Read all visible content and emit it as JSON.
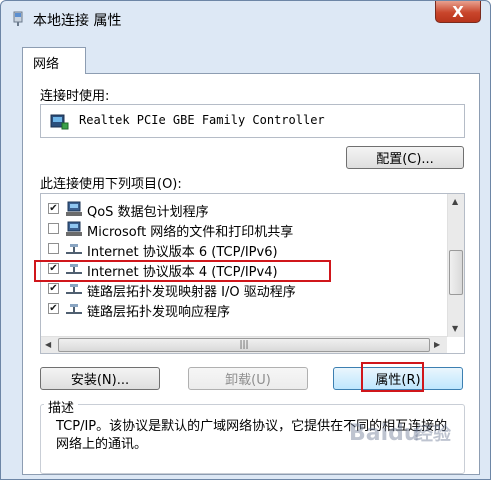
{
  "window": {
    "title": "本地连接 属性",
    "close_label": "X"
  },
  "tabs": [
    {
      "label": "网络"
    }
  ],
  "connect_using": {
    "label": "连接时使用:",
    "adapter": "Realtek PCIe GBE Family Controller",
    "configure_label": "配置(C)..."
  },
  "items_label": "此连接使用下列项目(O):",
  "items": [
    {
      "label": "QoS 数据包计划程序",
      "checked": true
    },
    {
      "label": "Microsoft 网络的文件和打印机共享",
      "checked": false
    },
    {
      "label": "Internet 协议版本 6 (TCP/IPv6)",
      "checked": false
    },
    {
      "label": "Internet 协议版本 4 (TCP/IPv4)",
      "checked": true
    },
    {
      "label": "链路层拓扑发现映射器 I/O 驱动程序",
      "checked": true
    },
    {
      "label": "链路层拓扑发现响应程序",
      "checked": true
    }
  ],
  "buttons": {
    "install": "安装(N)...",
    "uninstall": "卸载(U)",
    "properties": "属性(R)"
  },
  "description": {
    "title": "描述",
    "text": "TCP/IP。该协议是默认的广域网络协议，它提供在不同的相互连接的网络上的通讯。"
  },
  "watermark": "Baidu 经验",
  "colors": {
    "highlight_box": "#d0161b"
  }
}
